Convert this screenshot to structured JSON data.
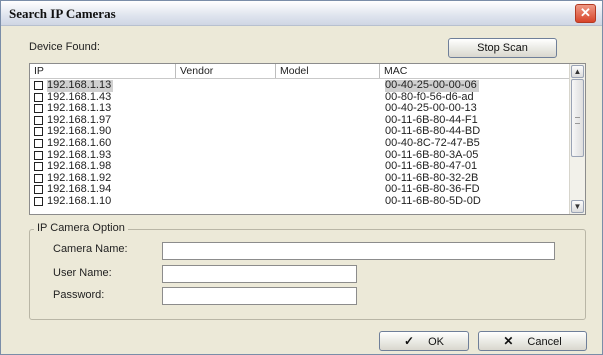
{
  "window": {
    "title": "Search IP Cameras",
    "close_icon": "close-x-icon"
  },
  "device_found_label": "Device Found:",
  "stop_scan_label": "Stop Scan",
  "columns": [
    "IP",
    "Vendor",
    "Model",
    "MAC"
  ],
  "devices": [
    {
      "ip": "192.168.1.13",
      "vendor": "",
      "model": "",
      "mac": "00-40-25-00-00-06",
      "selected": true
    },
    {
      "ip": "192.168.1.43",
      "vendor": "",
      "model": "",
      "mac": "00-80-f0-56-d6-ad"
    },
    {
      "ip": "192.168.1.13",
      "vendor": "",
      "model": "",
      "mac": "00-40-25-00-00-13"
    },
    {
      "ip": "192.168.1.97",
      "vendor": "",
      "model": "",
      "mac": "00-11-6B-80-44-F1"
    },
    {
      "ip": "192.168.1.90",
      "vendor": "",
      "model": "",
      "mac": "00-11-6B-80-44-BD"
    },
    {
      "ip": "192.168.1.60",
      "vendor": "",
      "model": "",
      "mac": "00-40-8C-72-47-B5"
    },
    {
      "ip": "192.168.1.93",
      "vendor": "",
      "model": "",
      "mac": "00-11-6B-80-3A-05"
    },
    {
      "ip": "192.168.1.98",
      "vendor": "",
      "model": "",
      "mac": "00-11-6B-80-47-01"
    },
    {
      "ip": "192.168.1.92",
      "vendor": "",
      "model": "",
      "mac": "00-11-6B-80-32-2B"
    },
    {
      "ip": "192.168.1.94",
      "vendor": "",
      "model": "",
      "mac": "00-11-6B-80-36-FD"
    },
    {
      "ip": "192.168.1.10",
      "vendor": "",
      "model": "",
      "mac": "00-11-6B-80-5D-0D"
    }
  ],
  "ip_camera_option": {
    "legend": "IP Camera Option",
    "camera_name_label": "Camera Name:",
    "camera_name_value": "",
    "user_name_label": "User Name:",
    "user_name_value": "",
    "password_label": "Password:",
    "password_value": ""
  },
  "buttons": {
    "ok_label": "OK",
    "ok_icon": "checkmark-icon",
    "cancel_label": "Cancel",
    "cancel_icon": "x-icon"
  }
}
